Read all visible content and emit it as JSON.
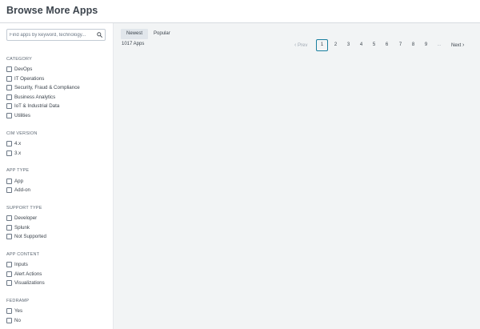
{
  "header": {
    "title": "Browse More Apps"
  },
  "search": {
    "placeholder": "Find apps by keyword, technology..."
  },
  "facets": [
    {
      "title": "CATEGORY",
      "options": [
        "DevOps",
        "IT Operations",
        "Security, Fraud & Compliance",
        "Business Analytics",
        "IoT & Industrial Data",
        "Utilities"
      ]
    },
    {
      "title": "CIM VERSION",
      "options": [
        "4.x",
        "3.x"
      ]
    },
    {
      "title": "APP TYPE",
      "options": [
        "App",
        "Add-on"
      ]
    },
    {
      "title": "SUPPORT TYPE",
      "options": [
        "Developer",
        "Splunk",
        "Not Supported"
      ]
    },
    {
      "title": "APP CONTENT",
      "options": [
        "Inputs",
        "Alert Actions",
        "Visualizations"
      ]
    },
    {
      "title": "FEDRAMP",
      "options": [
        "Yes",
        "No"
      ]
    }
  ],
  "sort_tabs": {
    "newest": "Newest",
    "popular": "Popular",
    "active": "Newest"
  },
  "results": {
    "count_label": "1017 Apps"
  },
  "pagination": {
    "prev": "Prev",
    "next": "Next",
    "prev_chevron": "‹",
    "next_chevron": "›",
    "pages": [
      "1",
      "2",
      "3",
      "4",
      "5",
      "6",
      "7",
      "8",
      "9"
    ],
    "ellipsis": "...",
    "current": "1"
  },
  "colors": {
    "accent": "#1a7fa0",
    "main_bg": "#f2f4f5",
    "text": "#3c444d"
  }
}
